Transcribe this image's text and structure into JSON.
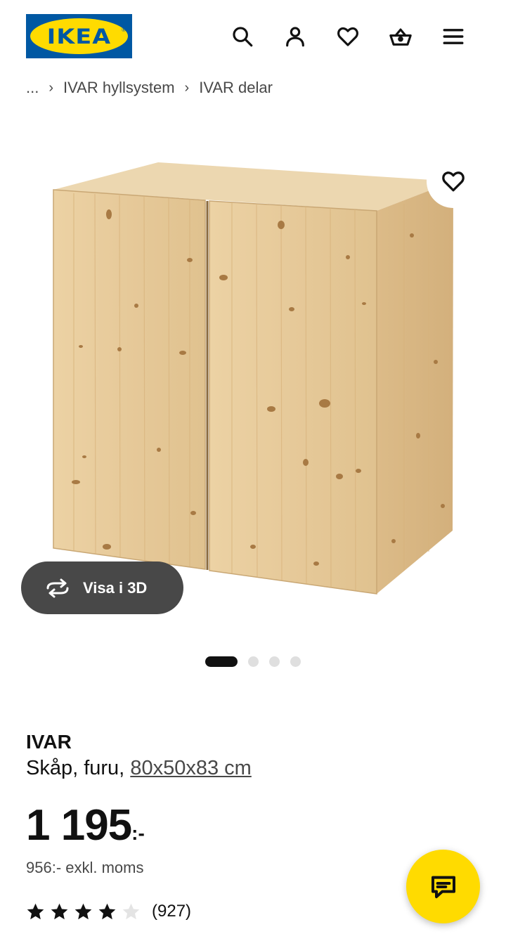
{
  "header": {
    "logo_text": "IKEA",
    "logo_mark": "®",
    "icons": [
      "search-icon",
      "user-icon",
      "heart-icon",
      "basket-icon",
      "menu-icon"
    ]
  },
  "breadcrumb": {
    "ellipsis": "...",
    "items": [
      "IVAR hyllsystem",
      "IVAR delar"
    ]
  },
  "product": {
    "name": "IVAR",
    "description": "Skåp, furu,",
    "size": "80x50x83 cm",
    "price": "1 195",
    "price_suffix": ":-",
    "price_excl": "956:- exkl. moms",
    "rating": 4,
    "rating_max": 5,
    "rating_count": "(927)"
  },
  "view3d": {
    "label": "Visa i 3D"
  },
  "carousel": {
    "count": 4,
    "active": 0
  },
  "colors": {
    "brand_blue": "#0058a3",
    "brand_yellow": "#ffdb00",
    "dark_button": "#484848"
  }
}
